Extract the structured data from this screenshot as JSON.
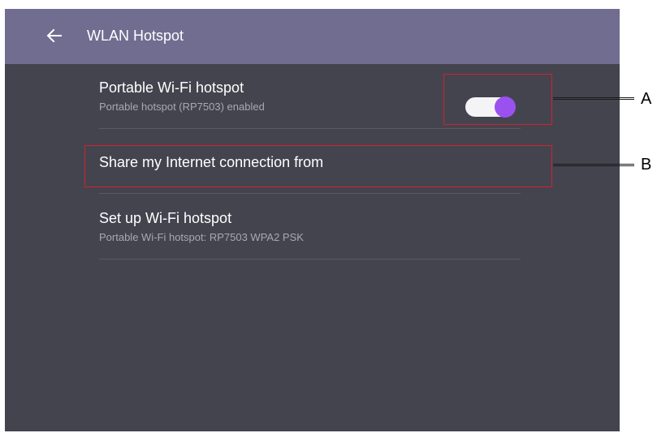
{
  "appbar": {
    "title": "WLAN Hotspot",
    "back_icon": "arrow-left-icon"
  },
  "settings": [
    {
      "title": "Portable Wi-Fi hotspot",
      "subtitle": "Portable hotspot (RP7503) enabled",
      "toggle_on": true
    },
    {
      "title": "Share my Internet connection from"
    },
    {
      "title": "Set up Wi-Fi hotspot",
      "subtitle": "Portable Wi-Fi hotspot: RP7503 WPA2 PSK"
    }
  ],
  "callouts": [
    "A",
    "B"
  ],
  "colors": {
    "screen_bg": "#44444f",
    "appbar_bg": "#706d91",
    "toggle_track": "#f4f4f6",
    "toggle_thumb": "#9b51f0",
    "callout_border": "#d1202e"
  }
}
